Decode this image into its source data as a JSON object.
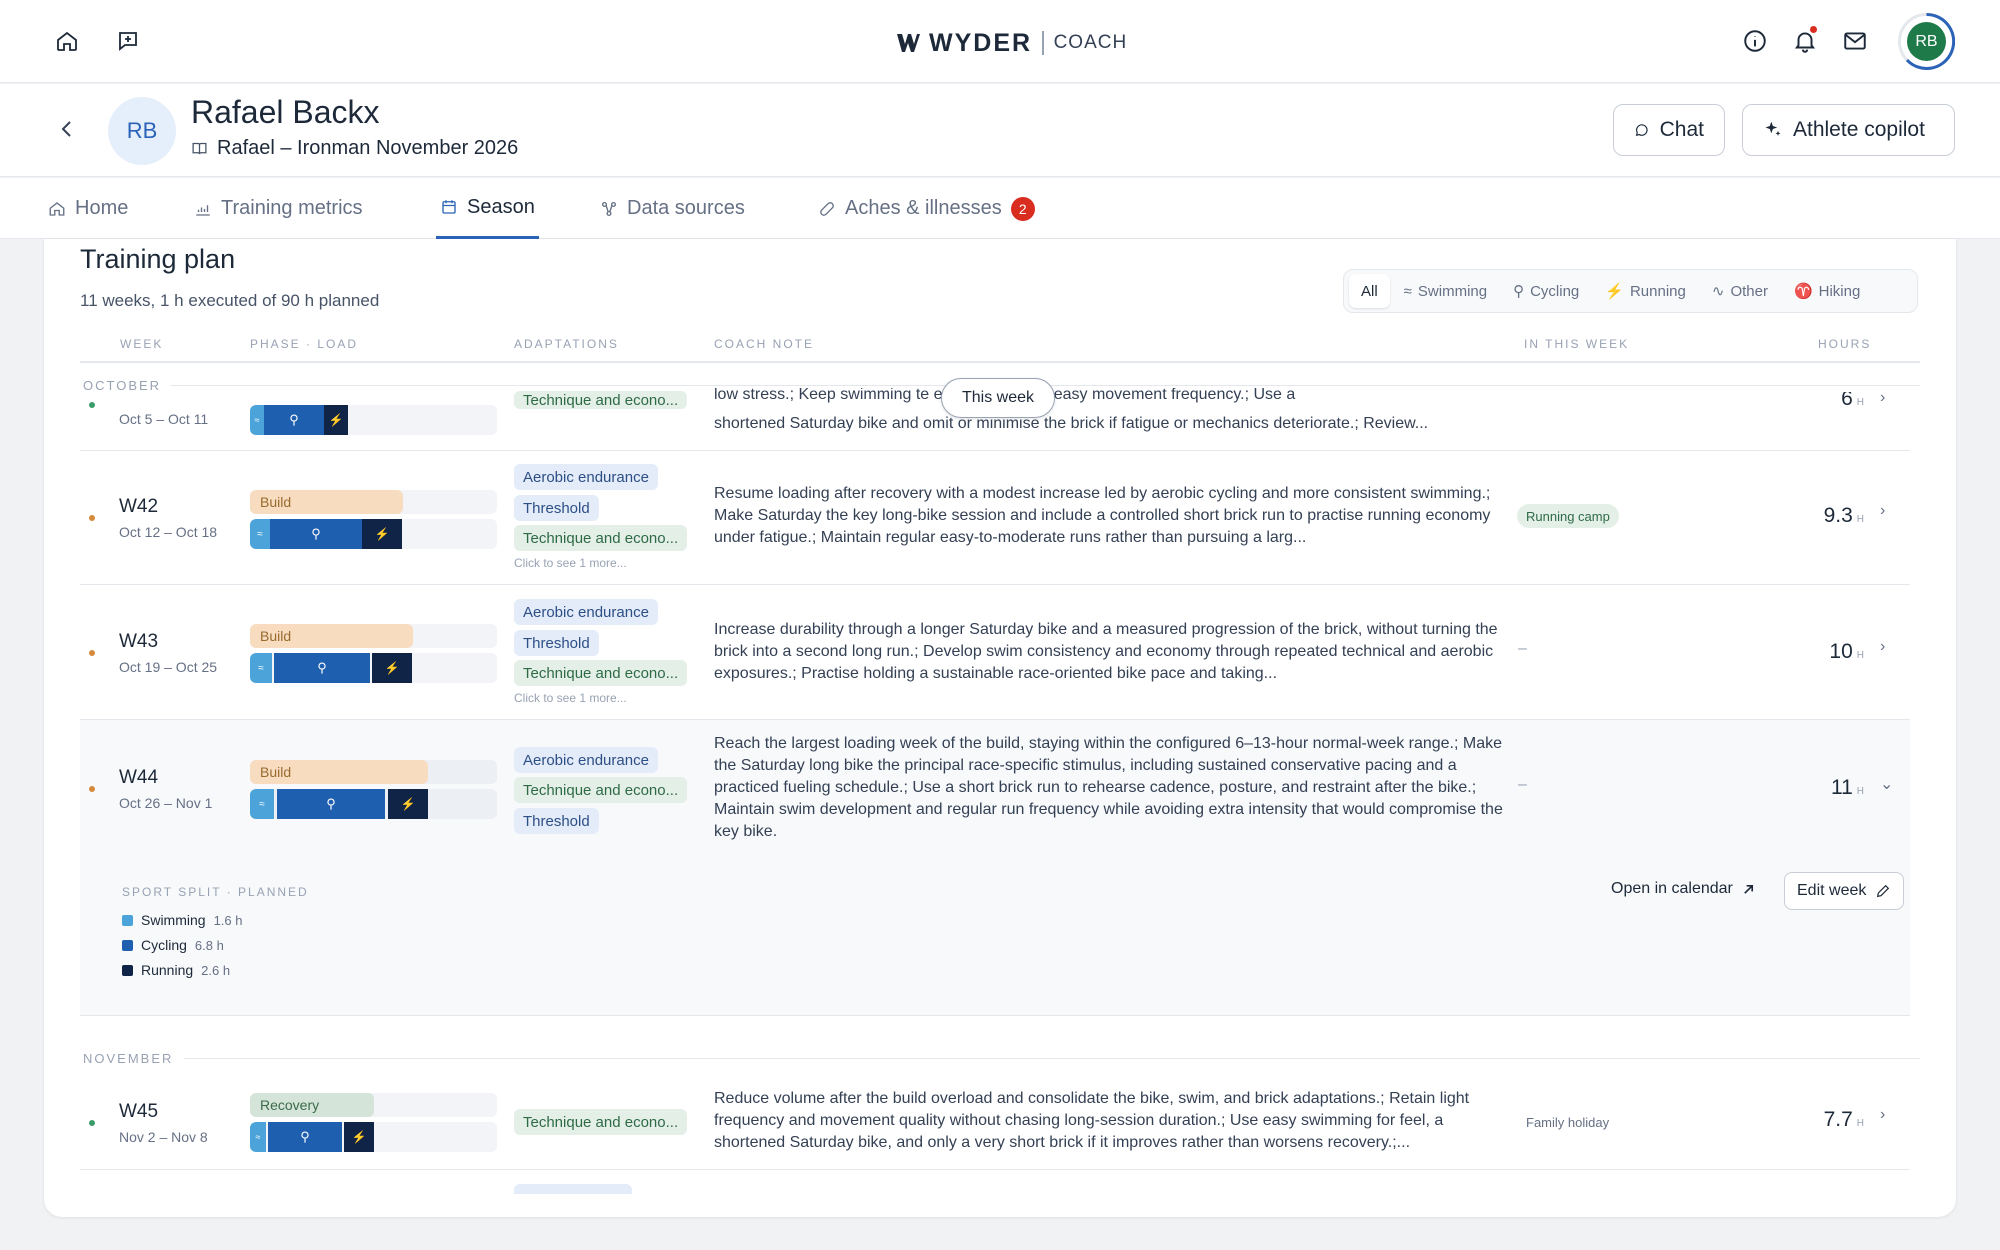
{
  "app": {
    "brand": "WYDER",
    "product": "COACH",
    "avatar_initials": "RB"
  },
  "athlete": {
    "initials": "RB",
    "name": "Rafael Backx",
    "plan": "Rafael – Ironman November 2026",
    "chat_label": "Chat",
    "copilot_label": "Athlete copilot"
  },
  "tabs": [
    {
      "label": "Home"
    },
    {
      "label": "Training metrics"
    },
    {
      "label": "Season",
      "active": true
    },
    {
      "label": "Data sources"
    },
    {
      "label": "Aches & illnesses",
      "badge": "2"
    }
  ],
  "plan": {
    "title": "Training plan",
    "subtitle": "11 weeks, 1 h executed of 90 h planned",
    "filters": [
      "All",
      "Swimming",
      "Cycling",
      "Running",
      "Other",
      "Hiking"
    ],
    "active_filter": "All",
    "columns": {
      "week": "WEEK",
      "phase_load": "PHASE · LOAD",
      "adaptations": "ADAPTATIONS",
      "coach_note": "COACH NOTE",
      "in_this_week": "IN THIS WEEK",
      "hours": "HOURS"
    },
    "this_week_label": "This week",
    "months": {
      "october": "OCTOBER",
      "november": "NOVEMBER"
    },
    "partial_row": {
      "dates": "Oct 5 – Oct 11",
      "chip": "Technique and econo...",
      "note_line1": "low stress.; Keep swimming te                              ed and preserve easy movement frequency.; Use a",
      "note_line2": "shortened Saturday bike and omit or minimise the brick if fatigue or mechanics deteriorate.; Review...",
      "hours": "6",
      "unit": "H"
    },
    "weeks": [
      {
        "week": "W42",
        "dates": "Oct 12 – Oct 18",
        "phase": "Build",
        "phase_fill": 0.62,
        "adaptations": [
          "Aerobic endurance",
          "Threshold",
          "Technique and econo..."
        ],
        "more": "Click to see 1 more...",
        "note": "Resume loading after recovery with a modest increase led by aerobic cycling and more consistent swimming.; Make Saturday the key long-bike session and include a controlled short brick run to practise running economy under fatigue.; Maintain regular easy-to-moderate runs rather than pursuing a larg...",
        "in_week": "Running camp",
        "hours": "9.3",
        "unit": "H"
      },
      {
        "week": "W43",
        "dates": "Oct 19 – Oct 25",
        "phase": "Build",
        "phase_fill": 0.66,
        "adaptations": [
          "Aerobic endurance",
          "Threshold",
          "Technique and econo..."
        ],
        "more": "Click to see 1 more...",
        "note": "Increase durability through a longer Saturday bike and a measured progression of the brick, without turning the brick into a second long run.; Develop swim consistency and economy through repeated technical and aerobic exposures.; Practise holding a sustainable race-oriented bike pace and taking...",
        "in_week": "–",
        "hours": "10",
        "unit": "H"
      },
      {
        "week": "W44",
        "dates": "Oct 26 – Nov 1",
        "phase": "Build",
        "phase_fill": 0.72,
        "adaptations": [
          "Aerobic endurance",
          "Technique and econo...",
          "Threshold"
        ],
        "note": "Reach the largest loading week of the build, staying within the configured 6–13-hour normal-week range.; Make the Saturday long bike the principal race-specific stimulus, including sustained conservative pacing and a practiced fueling schedule.; Use a short brick run to rehearse cadence, posture, and restraint after the bike.; Maintain swim development and regular run frequency while avoiding extra intensity that would compromise the key bike.",
        "in_week": "–",
        "hours": "11",
        "unit": "H"
      },
      {
        "week": "W45",
        "dates": "Nov 2 – Nov 8",
        "phase": "Recovery",
        "phase_fill": 0.5,
        "adaptations": [
          "Technique and econo..."
        ],
        "note": "Reduce volume after the build overload and consolidate the bike, swim, and brick adaptations.; Retain light frequency and movement quality without chasing long-session duration.; Use easy swimming for feel, a shortened Saturday bike, and only a very short brick if it improves rather than worsens recovery.;...",
        "in_week": "Family holiday",
        "hours": "7.7",
        "unit": "H"
      }
    ],
    "sport_split": {
      "heading": "SPORT SPLIT · PLANNED",
      "items": [
        {
          "sport": "Swimming",
          "value": "1.6 h",
          "color": "#4ba3d9"
        },
        {
          "sport": "Cycling",
          "value": "6.8 h",
          "color": "#1f5fb0"
        },
        {
          "sport": "Running",
          "value": "2.6 h",
          "color": "#0f2447"
        }
      ],
      "open_calendar": "Open in calendar",
      "edit_week": "Edit week"
    }
  },
  "colors": {
    "accent": "#2a63b8",
    "build": "#f7dcc0",
    "build_text": "#9a6a2e",
    "recovery": "#d4e4d8",
    "recovery_text": "#3b6b4a",
    "swim": "#4ba3d9",
    "bike": "#1f5fb0",
    "run": "#0f2447",
    "badge": "#d92d20"
  }
}
